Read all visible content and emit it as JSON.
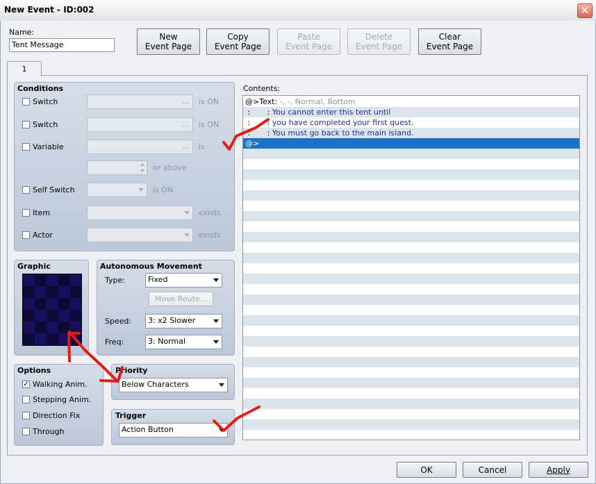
{
  "window": {
    "title": "New Event - ID:002",
    "close_glyph": "×"
  },
  "name": {
    "label": "Name:",
    "value": "Tent Message"
  },
  "toolbar": {
    "new_line1": "New",
    "new_line2": "Event Page",
    "copy_line1": "Copy",
    "copy_line2": "Event Page",
    "paste_line1": "Paste",
    "paste_line2": "Event Page",
    "delete_line1": "Delete",
    "delete_line2": "Event Page",
    "clear_line1": "Clear",
    "clear_line2": "Event Page"
  },
  "tab": {
    "label": "1"
  },
  "conditions": {
    "title": "Conditions",
    "switch1": {
      "label": "Switch",
      "suffix": "is ON",
      "ellipsis": "..."
    },
    "switch2": {
      "label": "Switch",
      "suffix": "is ON",
      "ellipsis": "..."
    },
    "variable": {
      "label": "Variable",
      "suffix": "is",
      "ellipsis": "...",
      "or_above": "or above"
    },
    "self_switch": {
      "label": "Self Switch",
      "suffix": "is ON"
    },
    "item": {
      "label": "Item",
      "suffix": "exists"
    },
    "actor": {
      "label": "Actor",
      "suffix": "exists"
    }
  },
  "contents": {
    "label": "Contents:",
    "rows": [
      {
        "cmd": "@>Text:",
        "text": " -, -, Normal, Bottom"
      },
      {
        "cmd": " :       :",
        "text": " You cannot enter this tent until"
      },
      {
        "cmd": " :       :",
        "text": " you have completed your first quest."
      },
      {
        "cmd": " :       :",
        "text": " You must go back to the main island."
      },
      {
        "cmd": "@>",
        "text": ""
      }
    ]
  },
  "graphic": {
    "title": "Graphic"
  },
  "movement": {
    "title": "Autonomous Movement",
    "type_label": "Type:",
    "type_value": "Fixed",
    "move_route": "Move Route...",
    "speed_label": "Speed:",
    "speed_value": "3: x2 Slower",
    "freq_label": "Freq:",
    "freq_value": "3: Normal"
  },
  "options": {
    "title": "Options",
    "walking": "Walking Anim.",
    "walking_checked": true,
    "stepping": "Stepping Anim.",
    "stepping_checked": false,
    "direction_fix": "Direction Fix",
    "direction_fix_checked": false,
    "through": "Through",
    "through_checked": false,
    "check_glyph": "✓"
  },
  "priority": {
    "title": "Priority",
    "value": "Below Characters"
  },
  "trigger": {
    "title": "Trigger",
    "value": "Action Button"
  },
  "footer": {
    "ok": "OK",
    "cancel": "Cancel",
    "apply": "Apply"
  },
  "annotation_color": "#e41b17"
}
